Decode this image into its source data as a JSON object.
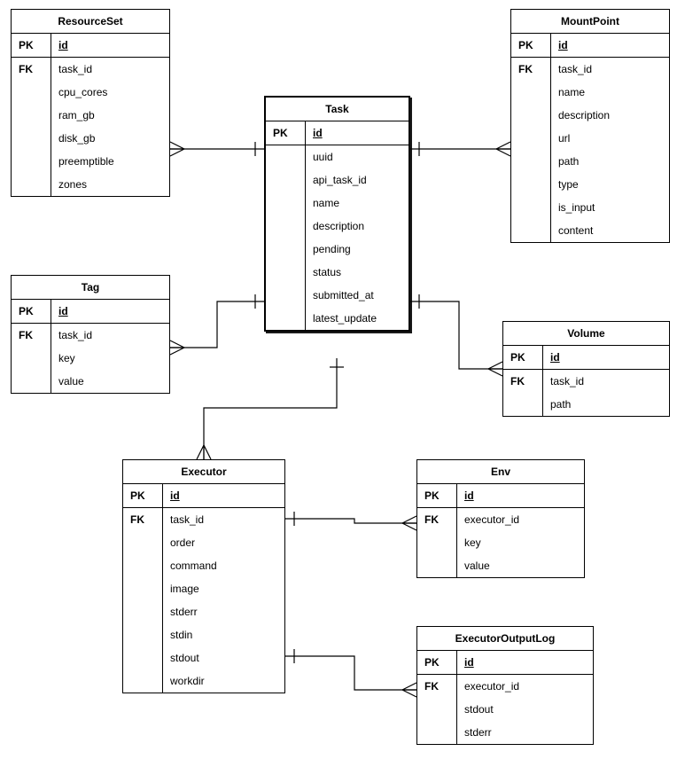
{
  "entities": {
    "resourceSet": {
      "title": "ResourceSet",
      "pk": {
        "key": "PK",
        "attr": "id"
      },
      "rows": [
        {
          "key": "FK",
          "attr": "task_id"
        },
        {
          "key": "",
          "attr": "cpu_cores"
        },
        {
          "key": "",
          "attr": "ram_gb"
        },
        {
          "key": "",
          "attr": "disk_gb"
        },
        {
          "key": "",
          "attr": "preemptible"
        },
        {
          "key": "",
          "attr": "zones"
        }
      ]
    },
    "tag": {
      "title": "Tag",
      "pk": {
        "key": "PK",
        "attr": "id"
      },
      "rows": [
        {
          "key": "FK",
          "attr": "task_id"
        },
        {
          "key": "",
          "attr": "key"
        },
        {
          "key": "",
          "attr": "value"
        }
      ]
    },
    "task": {
      "title": "Task",
      "pk": {
        "key": "PK",
        "attr": "id"
      },
      "rows": [
        {
          "key": "",
          "attr": "uuid"
        },
        {
          "key": "",
          "attr": "api_task_id"
        },
        {
          "key": "",
          "attr": "name"
        },
        {
          "key": "",
          "attr": "description"
        },
        {
          "key": "",
          "attr": "pending"
        },
        {
          "key": "",
          "attr": "status"
        },
        {
          "key": "",
          "attr": "submitted_at"
        },
        {
          "key": "",
          "attr": "latest_update"
        }
      ]
    },
    "mountPoint": {
      "title": "MountPoint",
      "pk": {
        "key": "PK",
        "attr": "id"
      },
      "rows": [
        {
          "key": "FK",
          "attr": "task_id"
        },
        {
          "key": "",
          "attr": "name"
        },
        {
          "key": "",
          "attr": "description"
        },
        {
          "key": "",
          "attr": "url"
        },
        {
          "key": "",
          "attr": "path"
        },
        {
          "key": "",
          "attr": "type"
        },
        {
          "key": "",
          "attr": "is_input"
        },
        {
          "key": "",
          "attr": "content"
        }
      ]
    },
    "volume": {
      "title": "Volume",
      "pk": {
        "key": "PK",
        "attr": "id"
      },
      "rows": [
        {
          "key": "FK",
          "attr": "task_id"
        },
        {
          "key": "",
          "attr": "path"
        }
      ]
    },
    "executor": {
      "title": "Executor",
      "pk": {
        "key": "PK",
        "attr": "id"
      },
      "rows": [
        {
          "key": "FK",
          "attr": "task_id"
        },
        {
          "key": "",
          "attr": "order"
        },
        {
          "key": "",
          "attr": "command"
        },
        {
          "key": "",
          "attr": "image"
        },
        {
          "key": "",
          "attr": "stderr"
        },
        {
          "key": "",
          "attr": "stdin"
        },
        {
          "key": "",
          "attr": "stdout"
        },
        {
          "key": "",
          "attr": "workdir"
        }
      ]
    },
    "env": {
      "title": "Env",
      "pk": {
        "key": "PK",
        "attr": "id"
      },
      "rows": [
        {
          "key": "FK",
          "attr": "executor_id"
        },
        {
          "key": "",
          "attr": "key"
        },
        {
          "key": "",
          "attr": "value"
        }
      ]
    },
    "executorOutputLog": {
      "title": "ExecutorOutputLog",
      "pk": {
        "key": "PK",
        "attr": "id"
      },
      "rows": [
        {
          "key": "FK",
          "attr": "executor_id"
        },
        {
          "key": "",
          "attr": "stdout"
        },
        {
          "key": "",
          "attr": "stderr"
        }
      ]
    }
  },
  "relationships": [
    {
      "from": "task",
      "to": "resourceSet"
    },
    {
      "from": "task",
      "to": "tag"
    },
    {
      "from": "task",
      "to": "mountPoint"
    },
    {
      "from": "task",
      "to": "volume"
    },
    {
      "from": "task",
      "to": "executor"
    },
    {
      "from": "executor",
      "to": "env"
    },
    {
      "from": "executor",
      "to": "executorOutputLog"
    }
  ]
}
